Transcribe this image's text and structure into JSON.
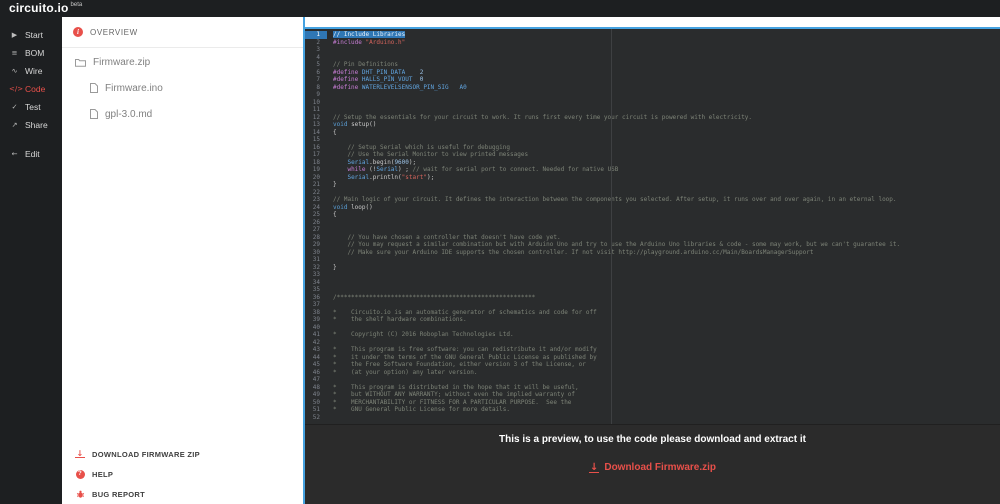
{
  "topbar": {
    "logo": "circuito.io",
    "beta_tag": "beta"
  },
  "sidebar": {
    "items": [
      {
        "label": "Start",
        "icon": "start-icon"
      },
      {
        "label": "BOM",
        "icon": "bom-icon"
      },
      {
        "label": "Wire",
        "icon": "wire-icon"
      },
      {
        "label": "Code",
        "icon": "code-icon",
        "active": true
      },
      {
        "label": "Test",
        "icon": "test-icon"
      },
      {
        "label": "Share",
        "icon": "share-icon"
      },
      {
        "label": "Edit",
        "icon": "edit-back-icon",
        "separated": true
      }
    ]
  },
  "file_panel": {
    "overview_label": "OVERVIEW",
    "files": [
      {
        "name": "Firmware.zip",
        "icon": "folder-icon",
        "indent": false
      },
      {
        "name": "Firmware.ino",
        "icon": "file-icon",
        "indent": true
      },
      {
        "name": "gpl-3.0.md",
        "icon": "file-icon",
        "indent": true
      }
    ],
    "actions": [
      {
        "label": "DOWNLOAD FIRMWARE ZIP",
        "icon": "download-icon"
      },
      {
        "label": "HELP",
        "icon": "help-icon"
      },
      {
        "label": "BUG REPORT",
        "icon": "bug-icon"
      }
    ]
  },
  "editor": {
    "active_line": 1,
    "lines": [
      {
        "n": 1,
        "sel": true,
        "segs": [
          [
            "c",
            "// Include Libraries"
          ]
        ]
      },
      {
        "n": 2,
        "segs": [
          [
            "pp",
            "#include "
          ],
          [
            "str",
            "\"Arduino.h\""
          ]
        ]
      },
      {
        "n": 3,
        "segs": []
      },
      {
        "n": 4,
        "segs": []
      },
      {
        "n": 5,
        "segs": [
          [
            "c",
            "// Pin Definitions"
          ]
        ]
      },
      {
        "n": 6,
        "segs": [
          [
            "pp",
            "#define "
          ],
          [
            "id",
            "DHT_PIN_DATA"
          ],
          [
            "pl",
            "    "
          ],
          [
            "num",
            "2"
          ]
        ]
      },
      {
        "n": 7,
        "segs": [
          [
            "pp",
            "#define "
          ],
          [
            "id",
            "HALLS_PIN_VOUT"
          ],
          [
            "pl",
            "  "
          ],
          [
            "num",
            "0"
          ]
        ]
      },
      {
        "n": 8,
        "segs": [
          [
            "pp",
            "#define "
          ],
          [
            "id",
            "WATERLEVELSENSOR_PIN_SIG"
          ],
          [
            "pl",
            "   "
          ],
          [
            "id",
            "A0"
          ]
        ]
      },
      {
        "n": 9,
        "segs": []
      },
      {
        "n": 10,
        "segs": []
      },
      {
        "n": 11,
        "segs": []
      },
      {
        "n": 12,
        "segs": [
          [
            "c",
            "// Setup the essentials for your circuit to work. It runs first every time your circuit is powered with electricity."
          ]
        ]
      },
      {
        "n": 13,
        "segs": [
          [
            "kt",
            "void"
          ],
          [
            "pl",
            " setup()"
          ]
        ]
      },
      {
        "n": 14,
        "segs": [
          [
            "pl",
            "{"
          ]
        ]
      },
      {
        "n": 15,
        "segs": []
      },
      {
        "n": 16,
        "segs": [
          [
            "c",
            "    // Setup Serial which is useful for debugging"
          ]
        ]
      },
      {
        "n": 17,
        "segs": [
          [
            "c",
            "    // Use the Serial Monitor to view printed messages"
          ]
        ]
      },
      {
        "n": 18,
        "segs": [
          [
            "pl",
            "    "
          ],
          [
            "id",
            "Serial"
          ],
          [
            "pl",
            ".begin("
          ],
          [
            "num",
            "9600"
          ],
          [
            "pl",
            ");"
          ]
        ]
      },
      {
        "n": 19,
        "segs": [
          [
            "pl",
            "    "
          ],
          [
            "kf",
            "while"
          ],
          [
            "pl",
            " (!"
          ],
          [
            "id",
            "Serial"
          ],
          [
            "pl",
            ") ; "
          ],
          [
            "c",
            "// wait for serial port to connect. Needed for native USB"
          ]
        ]
      },
      {
        "n": 20,
        "segs": [
          [
            "pl",
            "    "
          ],
          [
            "id",
            "Serial"
          ],
          [
            "pl",
            ".println("
          ],
          [
            "str",
            "\"start\""
          ],
          [
            "pl",
            ");"
          ]
        ]
      },
      {
        "n": 21,
        "segs": [
          [
            "pl",
            "}"
          ]
        ]
      },
      {
        "n": 22,
        "segs": []
      },
      {
        "n": 23,
        "segs": [
          [
            "c",
            "// Main logic of your circuit. It defines the interaction between the components you selected. After setup, it runs over and over again, in an eternal loop."
          ]
        ]
      },
      {
        "n": 24,
        "segs": [
          [
            "kt",
            "void"
          ],
          [
            "pl",
            " loop()"
          ]
        ]
      },
      {
        "n": 25,
        "segs": [
          [
            "pl",
            "{"
          ]
        ]
      },
      {
        "n": 26,
        "segs": []
      },
      {
        "n": 27,
        "segs": []
      },
      {
        "n": 28,
        "segs": [
          [
            "c",
            "    // You have chosen a controller that doesn't have code yet."
          ]
        ]
      },
      {
        "n": 29,
        "segs": [
          [
            "c",
            "    // You may request a similar combination but with Arduino Uno and try to use the Arduino Uno libraries & code - some may work, but we can't guarantee it."
          ]
        ]
      },
      {
        "n": 30,
        "segs": [
          [
            "c",
            "    // Make sure your Arduino IDE supports the chosen controller. If not visit http://playground.arduino.cc/Main/BoardsManagerSupport"
          ]
        ]
      },
      {
        "n": 31,
        "segs": []
      },
      {
        "n": 32,
        "segs": [
          [
            "pl",
            "}"
          ]
        ]
      },
      {
        "n": 33,
        "segs": []
      },
      {
        "n": 34,
        "segs": []
      },
      {
        "n": 35,
        "segs": []
      },
      {
        "n": 36,
        "segs": [
          [
            "c",
            "/*******************************************************"
          ]
        ]
      },
      {
        "n": 37,
        "segs": []
      },
      {
        "n": 38,
        "segs": [
          [
            "c",
            "*    Circuito.io is an automatic generator of schematics and code for off"
          ]
        ]
      },
      {
        "n": 39,
        "segs": [
          [
            "c",
            "*    the shelf hardware combinations."
          ]
        ]
      },
      {
        "n": 40,
        "segs": []
      },
      {
        "n": 41,
        "segs": [
          [
            "c",
            "*    Copyright (C) 2016 Roboplan Technologies Ltd."
          ]
        ]
      },
      {
        "n": 42,
        "segs": []
      },
      {
        "n": 43,
        "segs": [
          [
            "c",
            "*    This program is free software: you can redistribute it and/or modify"
          ]
        ]
      },
      {
        "n": 44,
        "segs": [
          [
            "c",
            "*    it under the terms of the GNU General Public License as published by"
          ]
        ]
      },
      {
        "n": 45,
        "segs": [
          [
            "c",
            "*    the Free Software Foundation, either version 3 of the License, or"
          ]
        ]
      },
      {
        "n": 46,
        "segs": [
          [
            "c",
            "*    (at your option) any later version."
          ]
        ]
      },
      {
        "n": 47,
        "segs": []
      },
      {
        "n": 48,
        "segs": [
          [
            "c",
            "*    This program is distributed in the hope that it will be useful,"
          ]
        ]
      },
      {
        "n": 49,
        "segs": [
          [
            "c",
            "*    but WITHOUT ANY WARRANTY; without even the implied warranty of"
          ]
        ]
      },
      {
        "n": 50,
        "segs": [
          [
            "c",
            "*    MERCHANTABILITY or FITNESS FOR A PARTICULAR PURPOSE.  See the"
          ]
        ]
      },
      {
        "n": 51,
        "segs": [
          [
            "c",
            "*    GNU General Public License for more details."
          ]
        ]
      },
      {
        "n": 52,
        "segs": []
      }
    ]
  },
  "preview": {
    "message": "This is a preview, to use the code please download and extract it",
    "download_label": "Download Firmware.zip"
  },
  "colors": {
    "accent": "#e8504a",
    "focus_blue": "#45a2e0",
    "editor_bg": "#2a2c2d"
  }
}
